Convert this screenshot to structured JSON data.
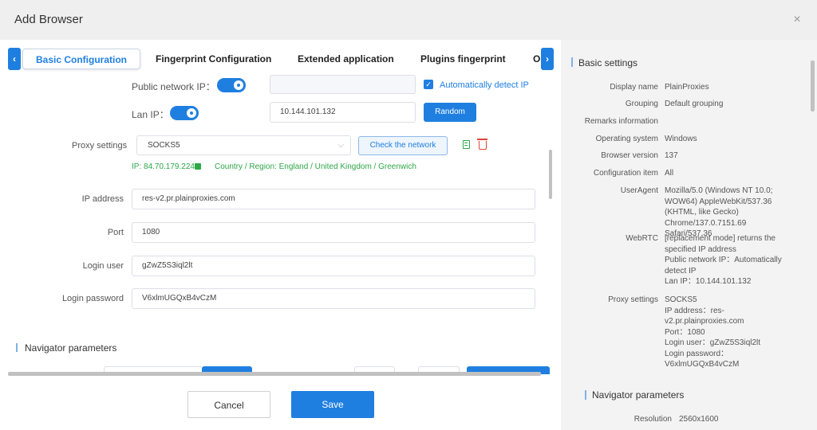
{
  "window": {
    "title": "Add Browser",
    "close": "×"
  },
  "tabs": {
    "prev": "‹",
    "next": "›",
    "items": [
      "Basic Configuration",
      "Fingerprint Configuration",
      "Extended application",
      "Plugins fingerprint",
      "O"
    ]
  },
  "form": {
    "public_ip_label": "Public network IP：",
    "auto_detect_label": "Automatically detect IP",
    "lan_ip_label": "Lan IP：",
    "lan_ip_value": "10.144.101.132",
    "random_button": "Random",
    "proxy_settings_label": "Proxy settings",
    "proxy_type": "SOCKS5",
    "check_network_button": "Check the network",
    "ip_info": "IP: 84.70.179.224",
    "location_info": "Country / Region: England / United Kingdom / Greenwich",
    "ip_address_label": "IP address",
    "ip_address_value": "res-v2.pr.plainproxies.com",
    "port_label": "Port",
    "port_value": "1080",
    "login_user_label": "Login user",
    "login_user_value": "gZwZ5S3iql2lt",
    "login_password_label": "Login password",
    "login_password_value": "V6xlmUGQxB4vCzM",
    "navigator_heading": "Navigator parameters"
  },
  "footer": {
    "cancel": "Cancel",
    "save": "Save"
  },
  "summary": {
    "heading": "Basic settings",
    "rows": [
      {
        "label": "Display name",
        "value": "PlainProxies"
      },
      {
        "label": "Grouping",
        "value": "Default grouping"
      },
      {
        "label": "Remarks information",
        "value": ""
      },
      {
        "label": "Operating system",
        "value": "Windows"
      },
      {
        "label": "Browser version",
        "value": "137"
      },
      {
        "label": "Configuration item",
        "value": "All"
      },
      {
        "label": "UserAgent",
        "value": "Mozilla/5.0 (Windows NT 10.0;\nWOW64) AppleWebKit/537.36\n(KHTML, like Gecko)\nChrome/137.0.7151.69 Safari/537.36"
      },
      {
        "label": "WebRTC",
        "value": "[replacement mode] returns the\nspecified IP address\nPublic network IP：Automatically\ndetect IP\nLan IP：10.144.101.132"
      },
      {
        "label": "Proxy settings",
        "value": "SOCKS5\nIP address：res-\nv2.pr.plainproxies.com\nPort：1080\nLogin user：gZwZ5S3iql2lt\nLogin password：\nV6xlmUGQxB4vCzM"
      }
    ],
    "navigator_heading": "Navigator parameters",
    "resolution_label": "Resolution",
    "resolution_value": "2560x1600"
  },
  "colors": {
    "accent": "#1f7fe0",
    "success": "#2ea848",
    "danger": "#e0443a"
  }
}
